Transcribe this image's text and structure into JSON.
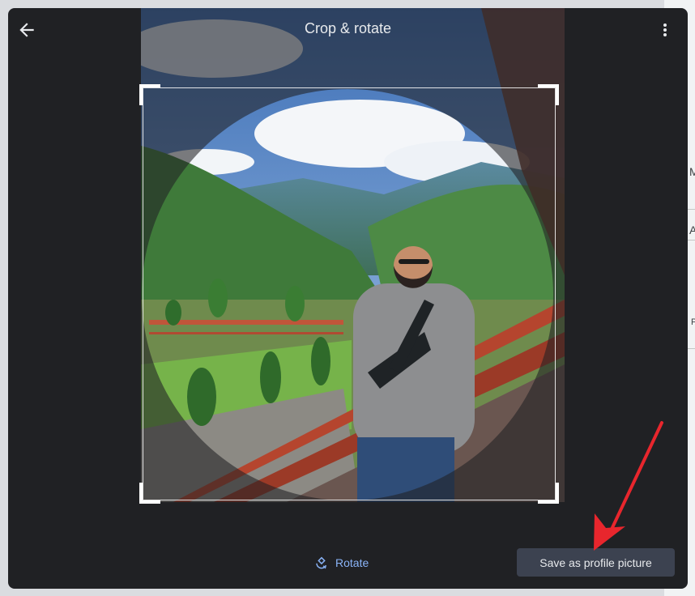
{
  "dialog": {
    "title": "Crop & rotate",
    "back_icon": "arrow-back-icon",
    "more_icon": "more-vert-icon"
  },
  "footer": {
    "rotate_label": "Rotate",
    "rotate_icon": "rotate-icon",
    "save_label": "Save as profile picture"
  },
  "background_page": {
    "letters": [
      "M",
      "A",
      "P"
    ]
  },
  "colors": {
    "dialog_bg": "#202124",
    "accent": "#8ab4f8",
    "save_button_bg": "#3c4250",
    "annotation_arrow": "#e8262d"
  }
}
